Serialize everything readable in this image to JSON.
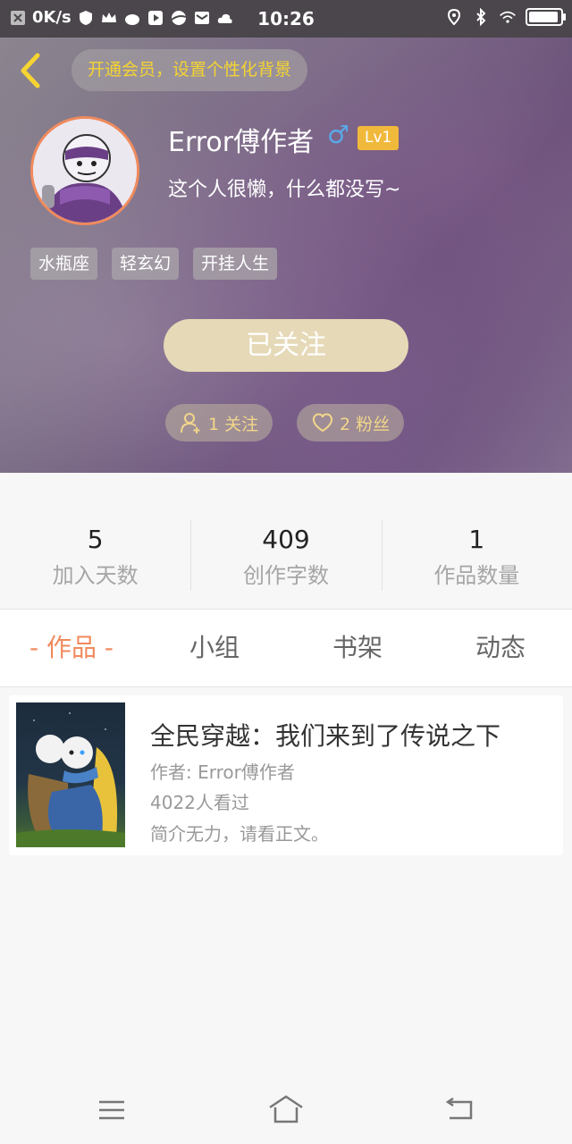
{
  "status_bar": {
    "net_speed": "0K/s",
    "time": "10:26",
    "battery_level": 0.95
  },
  "header": {
    "vip_prompt": "开通会员，设置个性化背景",
    "username": "Error傅作者",
    "gender_symbol": "♂",
    "level": "Lv1",
    "bio": "这个人很懒，什么都没写~",
    "tags": [
      "水瓶座",
      "轻玄幻",
      "开挂人生"
    ],
    "follow_button": "已关注",
    "following": "1 关注",
    "fans": "2 粉丝"
  },
  "stats": [
    {
      "value": "5",
      "label": "加入天数"
    },
    {
      "value": "409",
      "label": "创作字数"
    },
    {
      "value": "1",
      "label": "作品数量"
    }
  ],
  "tabs": [
    {
      "label": "- 作品 -"
    },
    {
      "label": "小组"
    },
    {
      "label": "书架"
    },
    {
      "label": "动态"
    }
  ],
  "book": {
    "title": "全民穿越：我们来到了传说之下",
    "author": "作者: Error傅作者",
    "views": "4022人看过",
    "intro": "简介无力，请看正文。"
  },
  "colors": {
    "accent": "#f08a5d",
    "vip_text": "#f5d432",
    "level_badge": "#f1b93c",
    "follow_button": "#e5d9b7"
  }
}
